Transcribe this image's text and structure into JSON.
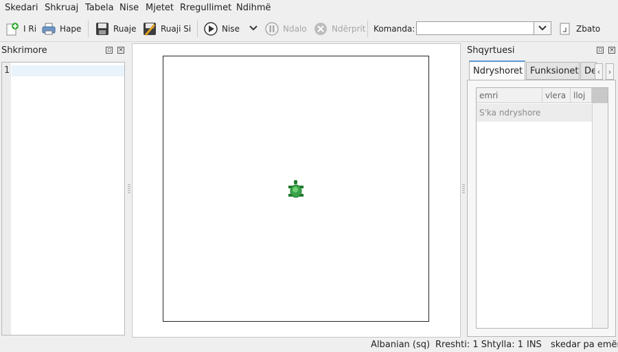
{
  "menubar": {
    "items": [
      {
        "label": "Skedari"
      },
      {
        "label": "Shkruaj"
      },
      {
        "label": "Tabela"
      },
      {
        "label": "Nise"
      },
      {
        "label": "Mjetet"
      },
      {
        "label": "Rregullimet"
      },
      {
        "label": "Ndihmë"
      }
    ]
  },
  "toolbar": {
    "new_label": "I Ri",
    "open_label": "Hape",
    "save_label": "Ruaje",
    "save_as_label": "Ruaji Si",
    "run_label": "Nise",
    "pause_label": "Ndalo",
    "stop_label": "Ndërprit",
    "command_label": "Komanda:",
    "command_value": "",
    "apply_label": "Zbato"
  },
  "editor_dock": {
    "title": "Shkrimore",
    "line_numbers": [
      "1"
    ]
  },
  "inspector_dock": {
    "title": "Shqyrtuesi",
    "tabs": [
      {
        "label": "Ndryshoret"
      },
      {
        "label": "Funksionet"
      },
      {
        "label": "De"
      }
    ],
    "columns": [
      "emri",
      "vlera",
      "lloj"
    ],
    "empty_message": "S'ka ndryshore"
  },
  "statusbar": {
    "language": "Albanian (sq)",
    "position": "Rreshti: 1 Shtylla: 1",
    "mode": "INS",
    "file": "skedar pa emër"
  },
  "colors": {
    "accent": "#5b97d6",
    "turtle": "#3aa34a"
  }
}
